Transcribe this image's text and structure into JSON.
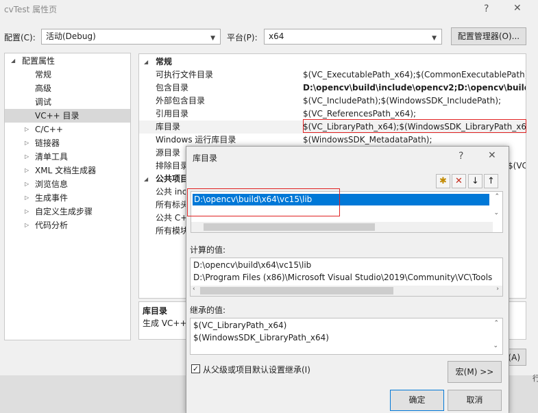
{
  "window": {
    "title": "cvTest 属性页",
    "help": "?",
    "close": "✕"
  },
  "toolbar": {
    "config_label": "配置(C):",
    "config_value": "活动(Debug)",
    "platform_label": "平台(P):",
    "platform_value": "x64",
    "config_manager": "配置管理器(O)..."
  },
  "tree": {
    "root": "配置属性",
    "items": [
      "常规",
      "高级",
      "调试",
      "VC++ 目录",
      "C/C++",
      "链接器",
      "清单工具",
      "XML 文档生成器",
      "浏览信息",
      "生成事件",
      "自定义生成步骤",
      "代码分析"
    ]
  },
  "grid": {
    "cat1": "常规",
    "rows": [
      {
        "name": "可执行文件目录",
        "value": "$(VC_ExecutablePath_x64);$(CommonExecutablePath)"
      },
      {
        "name": "包含目录",
        "value": "D:\\opencv\\build\\include\\opencv2;D:\\opencv\\build\\i"
      },
      {
        "name": "外部包含目录",
        "value": "$(VC_IncludePath);$(WindowsSDK_IncludePath);"
      },
      {
        "name": "引用目录",
        "value": "$(VC_ReferencesPath_x64);"
      },
      {
        "name": "库目录",
        "value": "$(VC_LibraryPath_x64);$(WindowsSDK_LibraryPath_x64)"
      },
      {
        "name": "Windows 运行库目录",
        "value": "$(WindowsSDK_MetadataPath);"
      },
      {
        "name": "源目录",
        "value": ""
      },
      {
        "name": "排除目录",
        "value": "$(VC_I"
      }
    ],
    "cat2": "公共项目",
    "rows2": [
      "公共 inc",
      "所有标头",
      "公共 C++",
      "所有模块"
    ]
  },
  "desc": {
    "title": "库目录",
    "text": "生成 VC++"
  },
  "outer_apply": "(A)",
  "outer_side": "行",
  "dialog": {
    "title": "库目录",
    "help": "?",
    "close": "✕",
    "toolbar": {
      "new": "✱",
      "delete": "✕",
      "down": "↓",
      "up": "↑"
    },
    "entry": "D:\\opencv\\build\\x64\\vc15\\lib",
    "computed_label": "计算的值:",
    "computed_lines": [
      "D:\\opencv\\build\\x64\\vc15\\lib",
      "D:\\Program Files (x86)\\Microsoft Visual Studio\\2019\\Community\\VC\\Tools"
    ],
    "inherited_label": "继承的值:",
    "inherited_lines": [
      "$(VC_LibraryPath_x64)",
      "$(WindowsSDK_LibraryPath_x64)"
    ],
    "inherit_checkbox": "从父级或项目默认设置继承(I)",
    "inherit_checked": true,
    "macro_button": "宏(M) >>",
    "ok": "确定",
    "cancel": "取消"
  },
  "colors": {
    "selection": "#0078d7",
    "highlight": "#e02020"
  }
}
